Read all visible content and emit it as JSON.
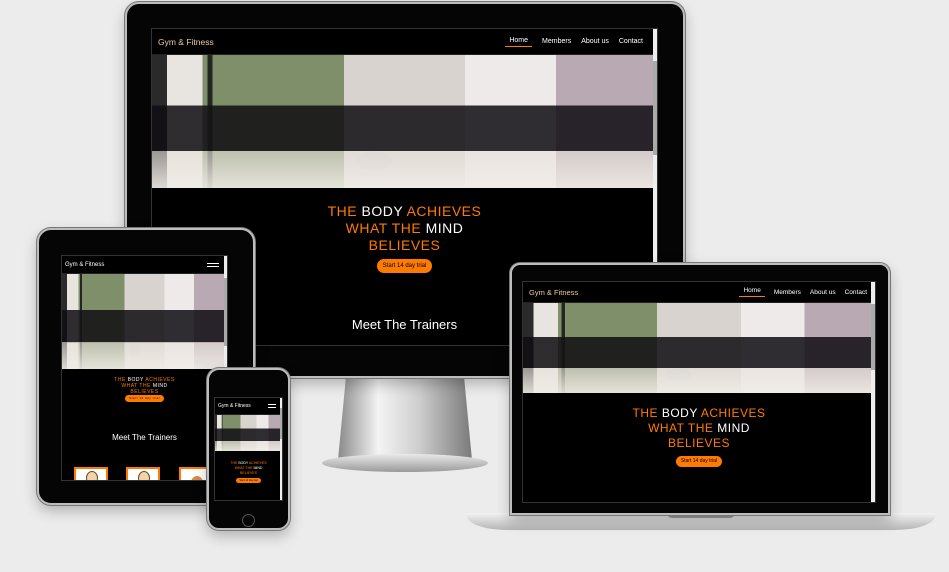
{
  "site": {
    "brand": "Gym & Fitness",
    "nav": [
      "Home",
      "Members",
      "About us",
      "Contact"
    ],
    "hero": {
      "w1": "THE",
      "w2": "BODY",
      "w3": "ACHIEVES",
      "w4": "WHAT THE",
      "w5": "MIND",
      "w6": "BELIEVES"
    },
    "cta": "Start 14 day trial",
    "trainers_heading": "Meet The Trainers"
  },
  "colors": {
    "accent": "#ff7a00",
    "background": "#000000",
    "brand": "#f0c9a0"
  },
  "icons": {
    "menu": "hamburger-icon"
  }
}
